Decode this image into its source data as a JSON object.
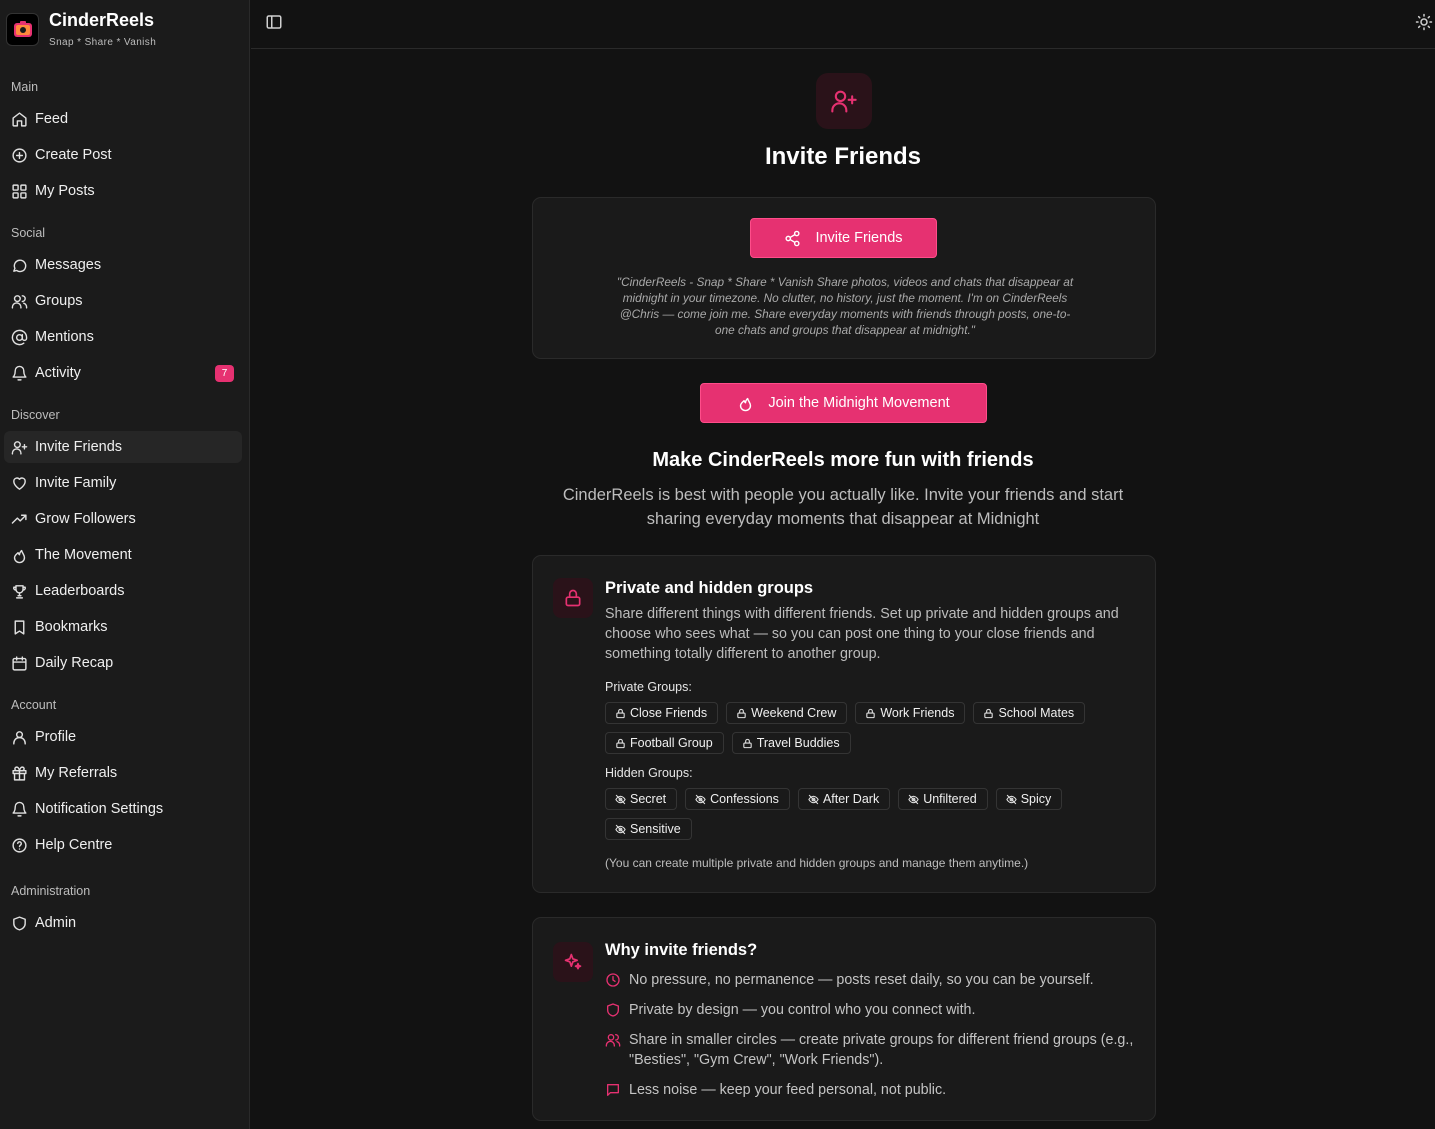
{
  "brand": {
    "name": "CinderReels",
    "tagline": "Snap * Share * Vanish"
  },
  "sidebar": {
    "sections": [
      {
        "title": "Main",
        "items": [
          {
            "label": "Feed",
            "icon": "home-icon"
          },
          {
            "label": "Create Post",
            "icon": "plus-circle-icon"
          },
          {
            "label": "My Posts",
            "icon": "grid-icon"
          }
        ]
      },
      {
        "title": "Social",
        "items": [
          {
            "label": "Messages",
            "icon": "message-icon"
          },
          {
            "label": "Groups",
            "icon": "users-icon"
          },
          {
            "label": "Mentions",
            "icon": "at-icon"
          },
          {
            "label": "Activity",
            "icon": "bell-icon",
            "badge": "7"
          }
        ]
      },
      {
        "title": "Discover",
        "items": [
          {
            "label": "Invite Friends",
            "icon": "user-plus-icon",
            "active": true
          },
          {
            "label": "Invite Family",
            "icon": "heart-icon"
          },
          {
            "label": "Grow Followers",
            "icon": "trending-up-icon"
          },
          {
            "label": "The Movement",
            "icon": "flame-icon"
          },
          {
            "label": "Leaderboards",
            "icon": "trophy-icon"
          },
          {
            "label": "Bookmarks",
            "icon": "bookmark-icon"
          },
          {
            "label": "Daily Recap",
            "icon": "calendar-icon"
          }
        ]
      },
      {
        "title": "Account",
        "items": [
          {
            "label": "Profile",
            "icon": "user-icon"
          },
          {
            "label": "My Referrals",
            "icon": "gift-icon"
          },
          {
            "label": "Notification Settings",
            "icon": "bell-icon"
          },
          {
            "label": "Help Centre",
            "icon": "help-circle-icon"
          }
        ]
      },
      {
        "title": "Administration",
        "items": [
          {
            "label": "Admin",
            "icon": "shield-icon"
          }
        ]
      }
    ]
  },
  "page": {
    "title": "Invite Friends",
    "invite_button": "Invite Friends",
    "invite_quote": "\"CinderReels - Snap * Share * Vanish Share photos, videos and chats that disappear at midnight in your timezone. No clutter, no history, just the moment. I'm on CinderReels @Chris — come join me. Share everyday moments with friends through posts, one-to-one chats and groups that disappear at midnight.\"",
    "movement_button": "Join the Midnight Movement",
    "subtitle": "Make CinderReels more fun with friends",
    "subtext": "CinderReels is best with people you actually like. Invite your friends and start sharing everyday moments that disappear at Midnight"
  },
  "groups_card": {
    "title": "Private and hidden groups",
    "description": "Share different things with different friends. Set up private and hidden groups and choose who sees what — so you can post one thing to your close friends and something totally different to another group.",
    "private_label": "Private Groups:",
    "private_groups": [
      "Close Friends",
      "Weekend Crew",
      "Work Friends",
      "School Mates",
      "Football Group",
      "Travel Buddies"
    ],
    "hidden_label": "Hidden Groups:",
    "hidden_groups": [
      "Secret",
      "Confessions",
      "After Dark",
      "Unfiltered",
      "Spicy",
      "Sensitive"
    ],
    "note": "(You can create multiple private and hidden groups and manage them anytime.)"
  },
  "why_card": {
    "title": "Why invite friends?",
    "items": [
      {
        "icon": "clock-icon",
        "text": "No pressure, no permanence — posts reset daily, so you can be yourself."
      },
      {
        "icon": "shield-icon",
        "text": "Private by design — you control who you connect with."
      },
      {
        "icon": "users-icon",
        "text": "Share in smaller circles — create private groups for different friend groups (e.g., \"Besties\", \"Gym Crew\", \"Work Friends\")."
      },
      {
        "icon": "message-icon",
        "text": "Less noise — keep your feed personal, not public."
      }
    ]
  },
  "colors": {
    "accent": "#e63171",
    "background": "#121212",
    "sidebar": "#1b1b1b",
    "card": "#1a1a1a"
  }
}
